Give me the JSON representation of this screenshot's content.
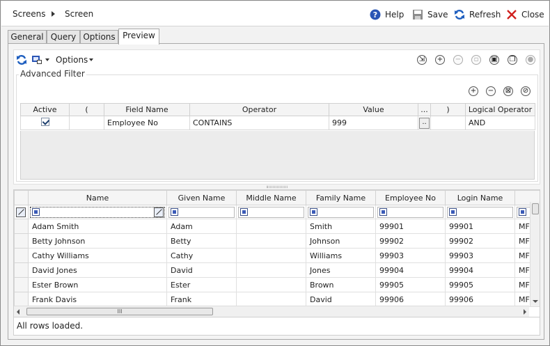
{
  "breadcrumb": {
    "root": "Screens",
    "current": "Screen"
  },
  "toolbar": {
    "help": "Help",
    "save": "Save",
    "refresh": "Refresh",
    "close": "Close"
  },
  "tabs": [
    {
      "label": "General"
    },
    {
      "label": "Query"
    },
    {
      "label": "Options"
    },
    {
      "label": "Preview"
    }
  ],
  "active_tab": "Preview",
  "options_menu": {
    "label": "Options"
  },
  "advanced_filter": {
    "legend": "Advanced Filter",
    "columns": [
      "Active",
      "(",
      "Field Name",
      "Operator",
      "Value",
      "...",
      ")",
      "Logical Operator"
    ],
    "rows": [
      {
        "active": true,
        "open_paren": "",
        "field_name": "Employee No",
        "operator": "CONTAINS",
        "value": "999",
        "ellipsis": "..",
        "close_paren": "",
        "logical_operator": "AND"
      }
    ]
  },
  "grid": {
    "columns": [
      "Name",
      "Given Name",
      "Middle Name",
      "Family Name",
      "Employee No",
      "Login Name",
      ""
    ],
    "rows": [
      [
        "Adam Smith",
        "Adam",
        "",
        "Smith",
        "99901",
        "99901",
        "MF"
      ],
      [
        "Betty Johnson",
        "Betty",
        "",
        "Johnson",
        "99902",
        "99902",
        "MF"
      ],
      [
        "Cathy Williams",
        "Cathy",
        "",
        "Williams",
        "99903",
        "99903",
        "MF"
      ],
      [
        "David Jones",
        "David",
        "",
        "Jones",
        "99904",
        "99904",
        "MF"
      ],
      [
        "Ester Brown",
        "Ester",
        "",
        "Brown",
        "99905",
        "99905",
        "MF"
      ],
      [
        "Frank Davis",
        "Frank",
        "",
        "David",
        "99906",
        "99906",
        "MF"
      ]
    ],
    "hscroll_label": "III"
  },
  "status": {
    "text": "All rows loaded."
  },
  "icons": {
    "help": "help-icon",
    "save": "save-icon",
    "refresh": "refresh-icon",
    "close": "close-icon"
  },
  "colors": {
    "accent": "#1f5fbf",
    "close_red": "#d0201e"
  }
}
